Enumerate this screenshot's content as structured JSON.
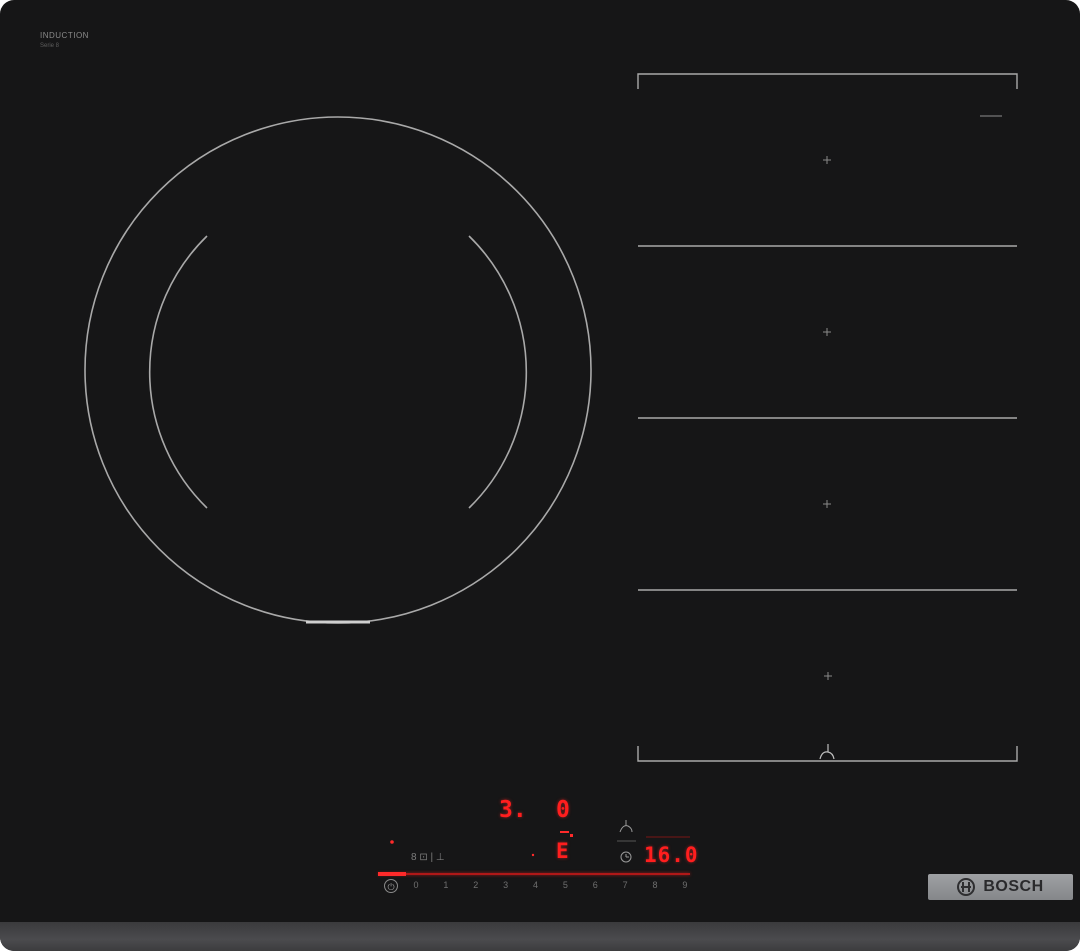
{
  "cooktop": {
    "brand_label": "INDUCTION",
    "brand_sub": "Serie 8",
    "logo_text": "BOSCH",
    "zone_marker": "+",
    "sensor_icon": "pan-sensor-icon"
  },
  "display": {
    "power_level": "3.",
    "zone_digit": "0",
    "setting_level": "E",
    "timer_value": "16.0",
    "zone_indicator": "8 ⊡ | ⊥",
    "power_symbol": "⏻",
    "slider_numbers": [
      "0",
      "1",
      "2",
      "3",
      "4",
      "5",
      "6",
      "7",
      "8",
      "9"
    ]
  },
  "colors": {
    "glass": "#161617",
    "display_red": "#ff1e1e",
    "line_grey": "#9a9a9a",
    "badge_silver": "#9fa1a4"
  }
}
